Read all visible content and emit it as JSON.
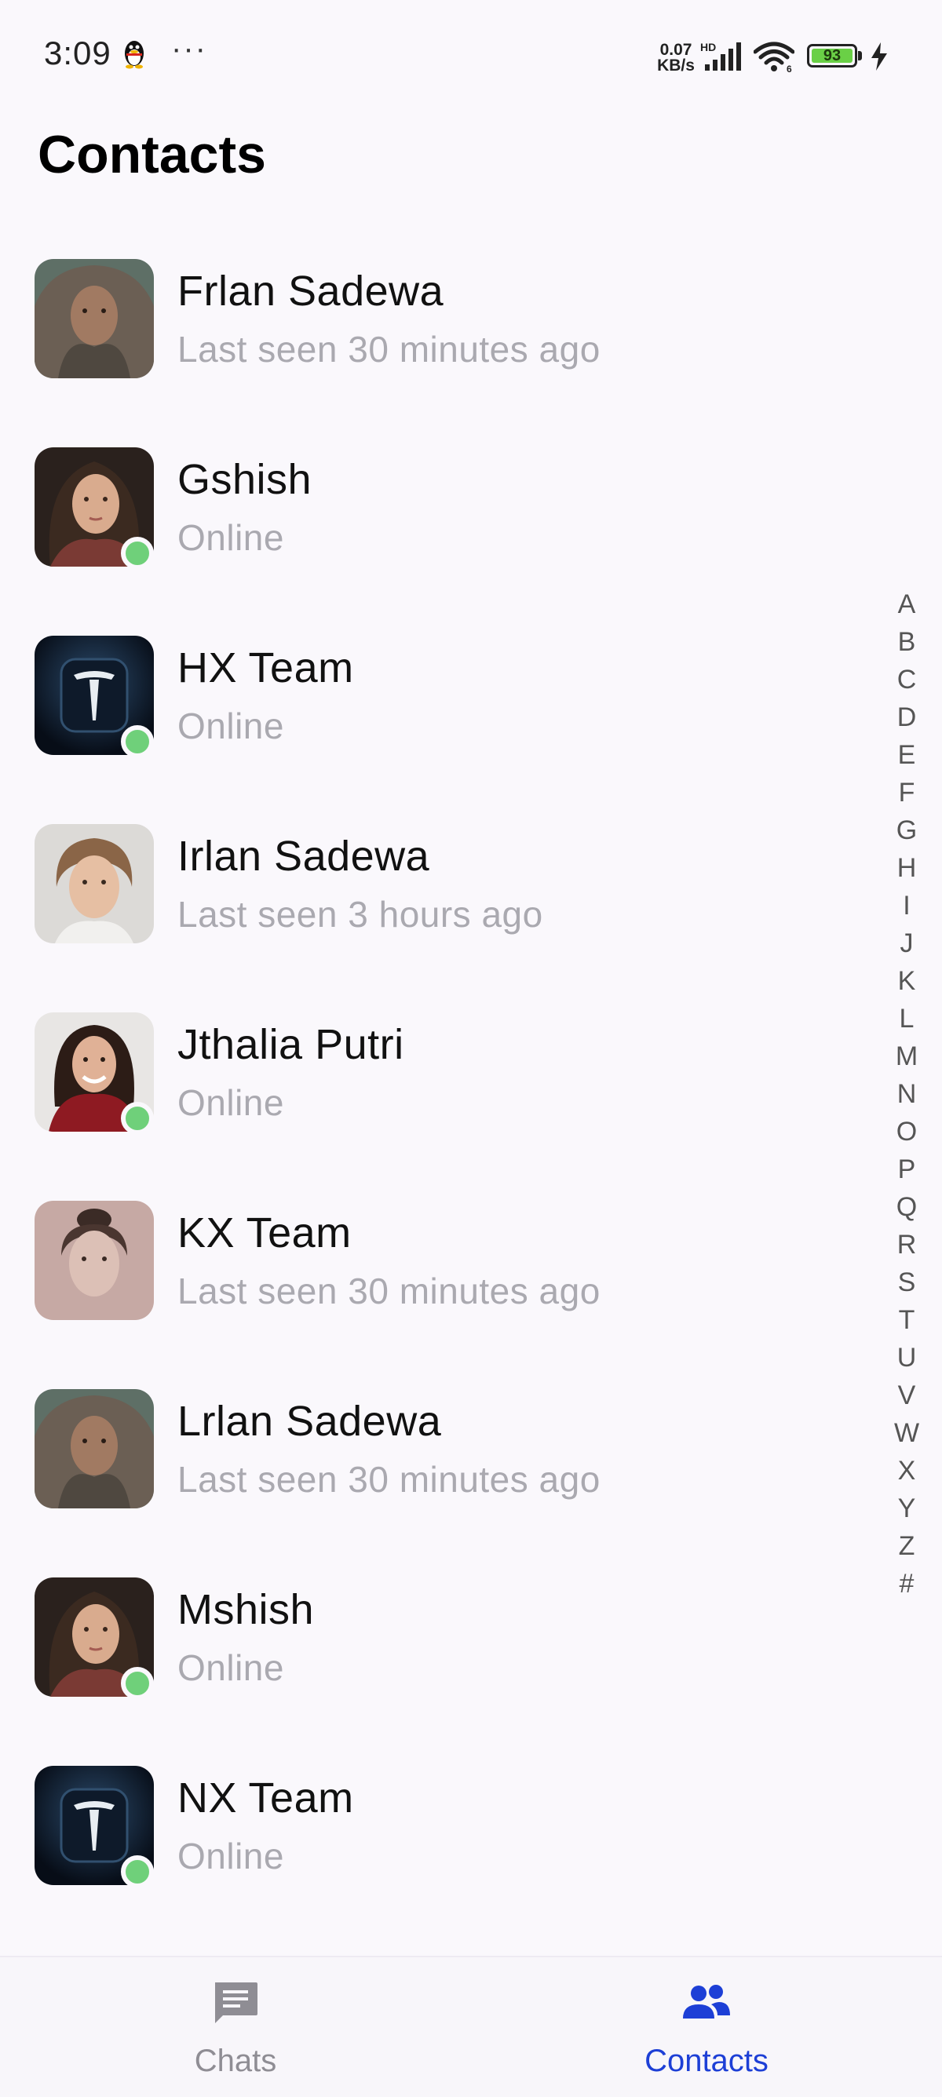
{
  "status_bar": {
    "time": "3:09",
    "more": "···",
    "net_speed_value": "0.07",
    "net_speed_unit": "KB/s",
    "hd": "HD",
    "battery": "93"
  },
  "header": {
    "title": "Contacts"
  },
  "contacts": [
    {
      "name": "Frlan Sadewa",
      "status": "Last seen 30 minutes ago",
      "online": false
    },
    {
      "name": "Gshish",
      "status": "Online",
      "online": true
    },
    {
      "name": "HX Team",
      "status": "Online",
      "online": true
    },
    {
      "name": "Irlan Sadewa",
      "status": "Last seen 3 hours ago",
      "online": false
    },
    {
      "name": "Jthalia Putri",
      "status": "Online",
      "online": true
    },
    {
      "name": "KX Team",
      "status": "Last seen 30 minutes ago",
      "online": false
    },
    {
      "name": "Lrlan Sadewa",
      "status": "Last seen 30 minutes ago",
      "online": false
    },
    {
      "name": "Mshish",
      "status": "Online",
      "online": true
    },
    {
      "name": "NX Team",
      "status": "Online",
      "online": true
    }
  ],
  "alphabet": [
    "A",
    "B",
    "C",
    "D",
    "E",
    "F",
    "G",
    "H",
    "I",
    "J",
    "K",
    "L",
    "M",
    "N",
    "O",
    "P",
    "Q",
    "R",
    "S",
    "T",
    "U",
    "V",
    "W",
    "X",
    "Y",
    "Z",
    "#"
  ],
  "bottom_nav": {
    "chats_label": "Chats",
    "contacts_label": "Contacts",
    "active": "contacts"
  },
  "colors": {
    "accent": "#1d3fd6",
    "online": "#6fd07a",
    "secondary_text": "#aaa9b0",
    "background": "#faf8fc"
  },
  "icons": {
    "chats": "chat-bubble-icon",
    "contacts": "people-icon"
  }
}
